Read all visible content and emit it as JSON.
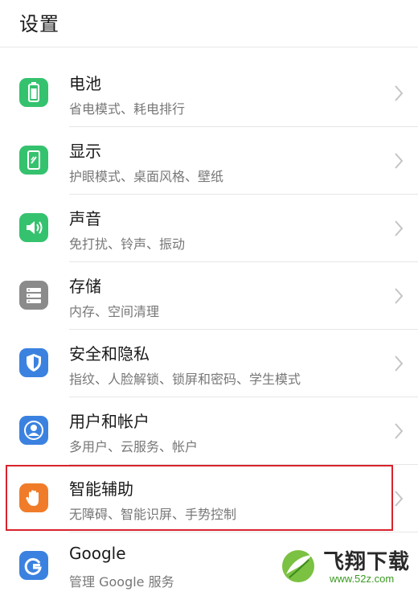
{
  "header": {
    "title": "设置"
  },
  "items": [
    {
      "title": "电池",
      "subtitle": "省电模式、耗电排行",
      "icon": "battery-icon",
      "color": "#35c26e"
    },
    {
      "title": "显示",
      "subtitle": "护眼模式、桌面风格、壁纸",
      "icon": "display-icon",
      "color": "#35c26e"
    },
    {
      "title": "声音",
      "subtitle": "免打扰、铃声、振动",
      "icon": "sound-icon",
      "color": "#35c26e"
    },
    {
      "title": "存储",
      "subtitle": "内存、空间清理",
      "icon": "storage-icon",
      "color": "#8b8b8b"
    },
    {
      "title": "安全和隐私",
      "subtitle": "指纹、人脸解锁、锁屏和密码、学生模式",
      "icon": "shield-icon",
      "color": "#3b82e0"
    },
    {
      "title": "用户和帐户",
      "subtitle": "多用户、云服务、帐户",
      "icon": "user-icon",
      "color": "#3b82e0"
    },
    {
      "title": "智能辅助",
      "subtitle": "无障碍、智能识屏、手势控制",
      "icon": "hand-icon",
      "color": "#f07c2a"
    },
    {
      "title": "Google",
      "subtitle": "管理 Google 服务",
      "icon": "google-icon",
      "color": "#3b82e0"
    }
  ],
  "watermark": {
    "text": "飞翔下载",
    "url": "www.52z.com"
  },
  "colors": {
    "highlight": "#d9232d"
  }
}
